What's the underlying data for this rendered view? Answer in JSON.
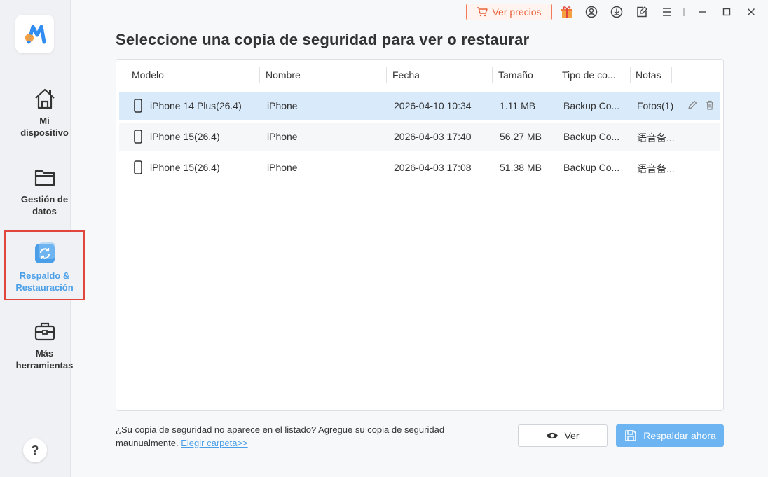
{
  "sidebar": {
    "items": [
      {
        "label_line1": "Mi",
        "label_line2": "dispositivo"
      },
      {
        "label_line1": "Gestión de",
        "label_line2": "datos"
      },
      {
        "label_line1": "Respaldo &",
        "label_line2": "Restauración"
      },
      {
        "label_line1": "Más",
        "label_line2": "herramientas"
      }
    ],
    "help": "?"
  },
  "topbar": {
    "price_label": "Ver precios"
  },
  "page": {
    "title": "Seleccione una copia de seguridad para ver o restaurar"
  },
  "table": {
    "headers": [
      "Modelo",
      "Nombre",
      "Fecha",
      "Tamaño",
      "Tipo de co...",
      "Notas"
    ],
    "rows": [
      {
        "model": "iPhone 14 Plus(26.4)",
        "name": "iPhone",
        "date": "2026-04-10 10:34",
        "size": "1.11 MB",
        "type": "Backup Co...",
        "notes": "Fotos(1)"
      },
      {
        "model": "iPhone 15(26.4)",
        "name": "iPhone",
        "date": "2026-04-03 17:40",
        "size": "56.27 MB",
        "type": "Backup Co...",
        "notes": "语音备..."
      },
      {
        "model": "iPhone 15(26.4)",
        "name": "iPhone",
        "date": "2026-04-03 17:08",
        "size": "51.38 MB",
        "type": "Backup Co...",
        "notes": "语音备..."
      }
    ]
  },
  "footer": {
    "note_text": "¿Su copia de seguridad no aparece en el listado? Agregue su copia de seguridad maunualmente. ",
    "link_text": "Elegir carpeta>>",
    "view_label": "Ver",
    "backup_label": "Respaldar ahora"
  },
  "colors": {
    "accent": "#4a9fe8",
    "primary_button": "#6db4f2",
    "selected_row": "#d9ebfb",
    "highlight_border": "#e0463c",
    "price_orange": "#e8613c"
  }
}
